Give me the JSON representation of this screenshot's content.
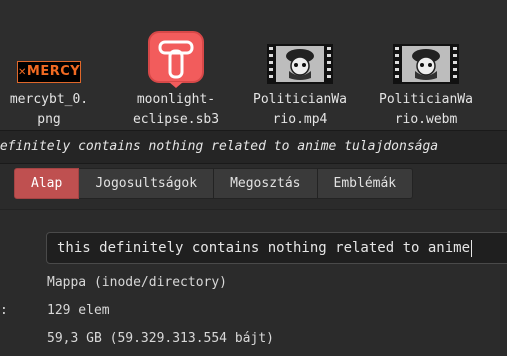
{
  "files": [
    {
      "name": "mercybt_0.\npng",
      "icon": "image-thumbnail",
      "thumb_text": "MERCY"
    },
    {
      "name": "moonlight-\neclipse.sb3",
      "icon": "scratch-logo",
      "thumb_text": "T"
    },
    {
      "name": "PoliticianWa\nrio.mp4",
      "icon": "video-thumbnail"
    },
    {
      "name": "PoliticianWa\nrio.webm",
      "icon": "video-thumbnail"
    }
  ],
  "dialog_title": "definitely contains nothing related to anime tulajdonsága",
  "tabs": [
    {
      "label": "Alap",
      "active": true
    },
    {
      "label": "Jogosultságok",
      "active": false
    },
    {
      "label": "Megosztás",
      "active": false
    },
    {
      "label": "Emblémák",
      "active": false
    }
  ],
  "name_field": {
    "value": "this definitely contains nothing related to anime"
  },
  "properties": {
    "type_value": "Mappa (inode/directory)",
    "contents_label": ":",
    "contents_value": "129 elem",
    "size_value": "59,3 GB (59.329.313.554 bájt)"
  },
  "colors": {
    "active_tab": "#bf5050",
    "background": "#2b2b2b",
    "scratch_red": "#f25c5c",
    "mercy_orange": "#f06a22"
  }
}
